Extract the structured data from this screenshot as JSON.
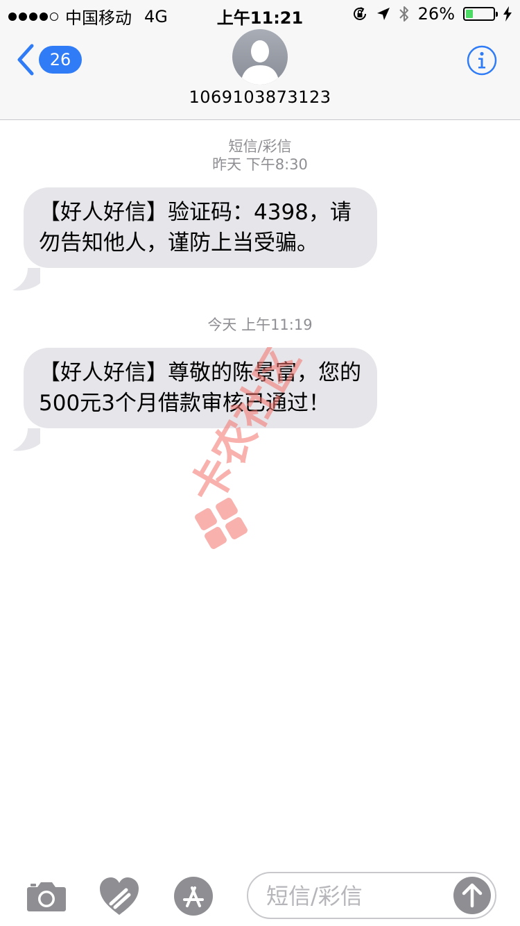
{
  "status_bar": {
    "carrier": "中国移动",
    "network": "4G",
    "time": "上午11:21",
    "battery_percent": "26%",
    "battery_level": 0.26,
    "signal_bars": 4
  },
  "header": {
    "back_badge": "26",
    "contact": "1069103873123",
    "back_color": "#2f7cf6"
  },
  "conversation": {
    "service_label": "短信/彩信",
    "messages": [
      {
        "timestamp": "昨天 下午8:30",
        "text": "【好人好信】验证码：4398，请勿告知他人，谨防上当受骗。"
      },
      {
        "timestamp": "今天 上午11:19",
        "text": "【好人好信】尊敬的陈景富，您的500元3个月借款审核已通过！"
      }
    ]
  },
  "watermark": {
    "text": "卡农社区"
  },
  "input_bar": {
    "placeholder": "短信/彩信",
    "icons": [
      "camera-icon",
      "digital-touch-icon",
      "app-store-icon",
      "send-arrow-icon"
    ]
  },
  "colors": {
    "accent": "#2f7cf6",
    "bubble": "#e5e5ea",
    "battery_fill": "#4cd964",
    "watermark": "#f4736b"
  }
}
